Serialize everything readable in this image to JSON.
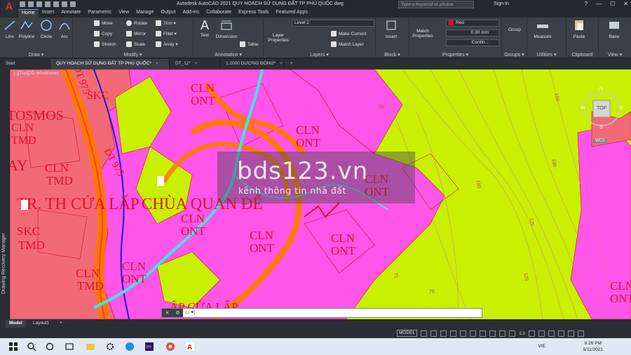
{
  "app": {
    "logo": "A",
    "title": "Autodesk AutoCAD 2021   QUY HOACH SỬ DỤNG ĐẤT TP PHÚ QUỐC.dwg",
    "search_placeholder": "Type a keyword or phrase",
    "sign_in": "Sign In",
    "help": "?",
    "win_min": "—",
    "win_max": "☐",
    "win_close": "✕"
  },
  "ribbon_tabs": [
    "Home",
    "Insert",
    "Annotate",
    "Parametric",
    "View",
    "Manage",
    "Output",
    "Add-ins",
    "Collaborate",
    "Express Tools",
    "Featured Apps"
  ],
  "ribbon": {
    "draw": {
      "title": "Draw ▾",
      "line": "Line",
      "polyline": "Polyline",
      "circle": "Circle",
      "arc": "Arc"
    },
    "modify": {
      "title": "Modify ▾",
      "move": "Move",
      "rotate": "Rotate",
      "trim": "Trim ▾",
      "copy": "Copy",
      "mirror": "Mirror",
      "fillet": "Fillet ▾",
      "stretch": "Stretch",
      "scale": "Scale",
      "array": "Array ▾"
    },
    "annotation": {
      "title": "Annotation ▾",
      "text": "Text",
      "dimension": "Dimension",
      "table": "Table"
    },
    "layers": {
      "title": "Layers ▾",
      "layer_properties": "Layer Properties",
      "current_layer": "Level 2",
      "make_current": "Make Current",
      "match_layer": "Match Layer"
    },
    "block": {
      "title": "Block ▾",
      "insert": "Insert"
    },
    "properties": {
      "title": "Properties ▾",
      "match_properties": "Match Properties",
      "color": "Red",
      "lineweight": "0.30 mm",
      "linetype": "Contin..."
    },
    "groups": {
      "title": "Groups ▾",
      "group": "Group"
    },
    "utilities": {
      "title": "Utilities ▾",
      "measure": "Measure"
    },
    "clipboard": {
      "title": "Clipboard",
      "paste": "Paste"
    },
    "view": {
      "title": "View ▾",
      "base": "Base"
    }
  },
  "doc_tabs": [
    {
      "label": "Start",
      "active": false
    },
    {
      "label": "QUY HOACH SỬ DỤNG ĐẤT TP PHÚ QUỐC*",
      "active": true
    },
    {
      "label": "DT_11*",
      "active": false
    },
    {
      "label": "1.2000 DƯƠNG ĐÔNG*",
      "active": false
    }
  ],
  "side_panel": "Drawing Recovery Manager",
  "viewport_label": "[-][Top][2D Wireframe]",
  "map_labels": [
    {
      "text": "SKC"
    },
    {
      "text": "TOSMOS"
    },
    {
      "text": "CLN"
    },
    {
      "text": "TMD"
    },
    {
      "text": "AY"
    },
    {
      "text": "CLN"
    },
    {
      "text": "TMD"
    },
    {
      "text": "CLN"
    },
    {
      "text": "ONT"
    },
    {
      "text": "CLN"
    },
    {
      "text": "ONT"
    },
    {
      "text": "TR. TH CỬA LẤP"
    },
    {
      "text": "CHÙA QUAN ĐẾ"
    },
    {
      "text": "SKC"
    },
    {
      "text": "TMD"
    },
    {
      "text": "CLN"
    },
    {
      "text": "ONT"
    },
    {
      "text": "CLN"
    },
    {
      "text": "ONT"
    },
    {
      "text": "CLN"
    },
    {
      "text": "ONT"
    },
    {
      "text": "CLN"
    },
    {
      "text": "ONT"
    },
    {
      "text": "CLN"
    },
    {
      "text": "TMD"
    },
    {
      "text": "CLN"
    },
    {
      "text": "ONT"
    },
    {
      "text": "ẤP CỬA LẤP"
    },
    {
      "text": "CLN"
    },
    {
      "text": "ONT"
    },
    {
      "text": "DT 975"
    },
    {
      "text": "DT 975"
    }
  ],
  "contour_labels": [
    "50",
    "100",
    "75",
    "125",
    "150",
    "100",
    "125",
    "75"
  ],
  "watermark": {
    "title": "bds123.vn",
    "subtitle": "kênh thông tin nhà đất"
  },
  "viewcube": {
    "face": "TOP",
    "n": "N",
    "s": "S",
    "e": "E",
    "w": "W",
    "wcs": "WCS"
  },
  "command_prompt": "▭ ▾|",
  "layout_tabs": [
    "Model",
    "Layout1",
    "+"
  ],
  "status": {
    "model": "MODEL",
    "scale": "1:1"
  },
  "taskbar": {
    "lang": "VIE",
    "time": "8:26 PM",
    "date": "5/11/2021"
  },
  "colors": {
    "bcs_green": "#c8f000",
    "residential_magenta": "#ff55e8",
    "commercial_salmon": "#f26a78",
    "road_orange": "#ff7a00",
    "river_cyan": "#3fe6e6",
    "label_red": "#e0102a"
  }
}
